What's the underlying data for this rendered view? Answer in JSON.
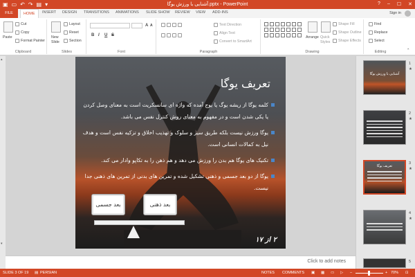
{
  "window": {
    "title": "آشنایی با ورزش یوگا.pptx - PowerPoint",
    "controls": [
      "?",
      "–",
      "☐",
      "✕"
    ]
  },
  "tabs": {
    "file": "FILE",
    "items": [
      "HOME",
      "INSERT",
      "DESIGN",
      "TRANSITIONS",
      "ANIMATIONS",
      "SLIDE SHOW",
      "REVIEW",
      "VIEW",
      "ADD-INS"
    ],
    "active": "HOME",
    "sign_in": "Sign in"
  },
  "ribbon": {
    "clipboard": {
      "label": "Clipboard",
      "paste": "Paste",
      "cut": "Cut",
      "copy": "Copy",
      "format_painter": "Format Painter"
    },
    "slides": {
      "label": "Slides",
      "new_slide_line1": "New",
      "new_slide_line2": "Slide",
      "layout": "Layout",
      "reset": "Reset",
      "section": "Section"
    },
    "font": {
      "label": "Font",
      "bold": "B",
      "italic": "I",
      "underline": "U",
      "strike": "S",
      "font_size_up": "A",
      "font_size_down": "A"
    },
    "paragraph": {
      "label": "Paragraph",
      "text_direction": "Text Direction",
      "align_text": "Align Text",
      "convert_smartart": "Convert to SmartArt"
    },
    "drawing": {
      "label": "Drawing",
      "arrange": "Arrange",
      "quick_styles_line1": "Quick",
      "quick_styles_line2": "Styles",
      "shape_fill": "Shape Fill",
      "shape_outline": "Shape Outline",
      "shape_effects": "Shape Effects"
    },
    "editing": {
      "label": "Editing",
      "find": "Find",
      "replace": "Replace",
      "select": "Select"
    }
  },
  "slide": {
    "title": "تعریف یوگا",
    "bullets": [
      "کلمه یوگا از ریشه یوگ یا یوج آمده که واژه ای سانسکریت است به معنای وصل کردن یا یکی شدن است و در مفهوم به معنای روش کنترل نفس می باشد.",
      "یوگا ورزش نیست بلکه طریق سیر و سلوک و تهذیب اخلاق و تزکیه نفس است و هدف نیل به کمالات انسانی است.",
      "تکنیک های یوگا هم بدن را ورزش می دهد و هم ذهن را به تکاپو وادار می کند.",
      "یوگا از دو بعد جسمی و ذهنی تشکیل شده و تمرین های بدنی از تمرین های ذهنی جدا نیست."
    ],
    "scale_left": "بعد جسمی",
    "scale_right": "بعد ذهنی",
    "page_number": "۲ از ۱۷"
  },
  "notes_placeholder": "Click to add notes",
  "thumbnails": [
    {
      "number": "1",
      "title": "آشنایی با ورزش یوگا",
      "selected": false
    },
    {
      "number": "2",
      "title": "",
      "selected": false
    },
    {
      "number": "3",
      "title": "تعریف یوگا",
      "selected": true
    },
    {
      "number": "4",
      "title": "",
      "selected": false
    },
    {
      "number": "5",
      "title": "",
      "selected": false
    }
  ],
  "status": {
    "slide_of": "SLIDE 3 OF 19",
    "language": "PERSIAN",
    "notes": "NOTES",
    "comments": "COMMENTS",
    "zoom": "70%"
  },
  "colors": {
    "accent": "#d24726",
    "bullet": "#4a86c8"
  }
}
